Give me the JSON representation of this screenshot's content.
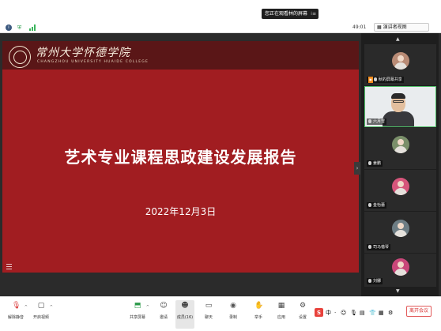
{
  "banner": {
    "text": "您正在观看林的屏幕",
    "options": "⁞≡"
  },
  "toolbar_top": {
    "timer": "49:01",
    "view_button": "▦ 演讲者视图"
  },
  "slide": {
    "college_name": "常州大学怀德学院",
    "college_english": "CHANGZHOU UNIVERSITY HUAIDE COLLEGE",
    "title": "艺术专业课程思政建设发展报告",
    "date": "2022年12月3日"
  },
  "panel": {
    "up_arrow": "▲",
    "down_arrow": "▼",
    "participants": [
      {
        "name": "秋的屏幕共享",
        "badge": "▣",
        "type": "avatar",
        "avatar_color": "#b98b75"
      },
      {
        "name": "六月雪",
        "type": "video"
      },
      {
        "name": "姜鹏",
        "type": "avatar",
        "avatar_color": "#7a8f6a"
      },
      {
        "name": "金怡蕾",
        "type": "avatar",
        "avatar_color": "#d6557b"
      },
      {
        "name": "司马蓓琴",
        "type": "avatar",
        "avatar_color": "#6d7d84"
      },
      {
        "name": "刘娜",
        "type": "avatar",
        "avatar_color": "#c9477a"
      }
    ]
  },
  "bottom": {
    "tools": [
      {
        "key": "mute",
        "label": "解除静音",
        "icon": "mic-muted-icon",
        "glyph": "🎙"
      },
      {
        "key": "video",
        "label": "开启视频",
        "icon": "camera-off-icon",
        "glyph": "▢"
      },
      {
        "key": "share",
        "label": "共享屏幕",
        "icon": "share-screen-icon",
        "glyph": "⬒"
      },
      {
        "key": "invite",
        "label": "邀请",
        "icon": "invite-icon",
        "glyph": "☺"
      },
      {
        "key": "participants",
        "label": "成员(16)",
        "icon": "participants-icon",
        "glyph": "☻"
      },
      {
        "key": "chat",
        "label": "聊天",
        "icon": "chat-icon",
        "glyph": "▭"
      },
      {
        "key": "record",
        "label": "录制",
        "icon": "record-icon",
        "glyph": "◉"
      },
      {
        "key": "raise",
        "label": "举手",
        "icon": "raise-hand-icon",
        "glyph": "✋"
      },
      {
        "key": "apps",
        "label": "应用",
        "icon": "apps-icon",
        "glyph": "▦"
      },
      {
        "key": "settings",
        "label": "设置",
        "icon": "settings-icon",
        "glyph": "⚙"
      }
    ],
    "leave_label": "离开会议",
    "ime": {
      "logo": "S",
      "items": [
        "中",
        "·",
        "☺",
        "🎙",
        "▤",
        "👕",
        "▦",
        "⚙"
      ]
    }
  },
  "colors": {
    "slide_bg": "#a11d21",
    "accent_green": "#4fbf67",
    "leave_red": "#d93636"
  }
}
